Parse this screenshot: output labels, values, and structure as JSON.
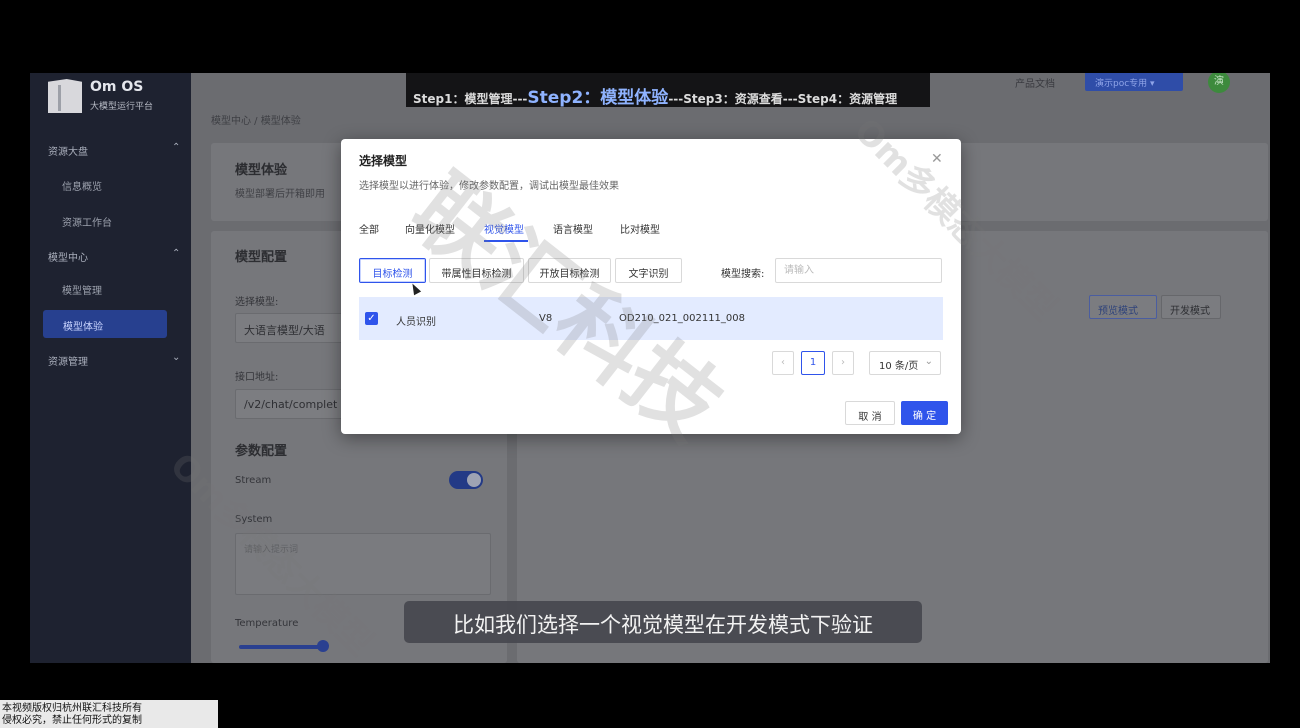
{
  "sidebar": {
    "brand_name": "Om OS",
    "brand_sub": "大模型运行平台",
    "groups": [
      {
        "label": "资源大盘",
        "items": [
          "信息概览",
          "资源工作台"
        ]
      },
      {
        "label": "模型中心",
        "items": [
          "模型管理",
          "模型体验"
        ]
      },
      {
        "label": "资源管理",
        "items": []
      }
    ]
  },
  "topbar": {
    "doc_link": "产品文档",
    "user": "演示poc专用 ▾",
    "avatar": "演"
  },
  "breadcrumb": "模型中心 / 模型体验",
  "header_card": {
    "title": "模型体验",
    "desc": "模型部署后开箱即用"
  },
  "config": {
    "title": "模型配置",
    "select_label": "选择模型:",
    "select_value": "大语言模型/大语",
    "api_label": "接口地址:",
    "api_value": "/v2/chat/complet",
    "params_title": "参数配置",
    "stream_label": "Stream",
    "system_label": "System",
    "system_placeholder": "请输入提示词",
    "temperature_label": "Temperature"
  },
  "mode_buttons": [
    "预览模式",
    "开发模式"
  ],
  "steps": {
    "s1": "Step1：模型管理---",
    "s2": "Step2：模型体验",
    "s3": "---Step3：资源查看---Step4：资源管理"
  },
  "modal": {
    "title": "选择模型",
    "desc": "选择模型以进行体验，修改参数配置，调试出模型最佳效果",
    "tabs": [
      "全部",
      "向量化模型",
      "视觉模型",
      "语言模型",
      "比对模型"
    ],
    "active_tab": "视觉模型",
    "chips": [
      "目标检测",
      "带属性目标检测",
      "开放目标检测",
      "文字识别"
    ],
    "active_chip": "目标检测",
    "search_label": "模型搜索:",
    "search_placeholder": "请输入",
    "row": {
      "name": "人员识别",
      "version": "V8",
      "code": "OD210_021_002111_008"
    },
    "page": "1",
    "page_size": "10 条/页",
    "cancel": "取 消",
    "ok": "确 定"
  },
  "watermark": {
    "text1": "联汇科技",
    "text2": "Om多模态大模型"
  },
  "subtitle": "比如我们选择一个视觉模型在开发模式下验证",
  "copyright": {
    "line1": "本视频版权归杭州联汇科技所有",
    "line2": "侵权必究，禁止任何形式的复制"
  },
  "colors": {
    "primary": "#2f54eb",
    "sidebar": "#1e2230",
    "row_selected": "#e3ebff"
  }
}
